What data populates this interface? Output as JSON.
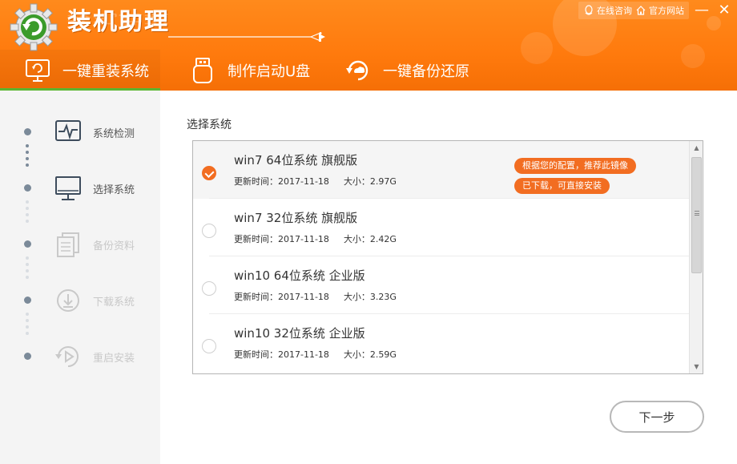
{
  "app": {
    "title": "装机助理",
    "online_consult": "在线咨询",
    "official_site": "官方网站",
    "minimize_glyph": "—",
    "close_glyph": "✕"
  },
  "tabs": [
    {
      "label": "一键重装系统",
      "icon": "reinstall-monitor-icon",
      "active": true
    },
    {
      "label": "制作启动U盘",
      "icon": "usb-drive-icon",
      "active": false
    },
    {
      "label": "一键备份还原",
      "icon": "backup-restore-icon",
      "active": false
    }
  ],
  "steps": [
    {
      "label": "系统检测",
      "icon": "pulse-monitor-icon",
      "state": "done"
    },
    {
      "label": "选择系统",
      "icon": "desktop-monitor-icon",
      "state": "done"
    },
    {
      "label": "备份资料",
      "icon": "documents-icon",
      "state": "pending"
    },
    {
      "label": "下载系统",
      "icon": "download-icon",
      "state": "pending"
    },
    {
      "label": "重启安装",
      "icon": "restart-play-icon",
      "state": "pending"
    }
  ],
  "main": {
    "section_title": "选择系统",
    "systems": [
      {
        "name": "win7 64位系统 旗舰版",
        "update_label": "更新时间：2017-11-18",
        "size_label": "大小：2.97G",
        "selected": true
      },
      {
        "name": "win7 32位系统 旗舰版",
        "update_label": "更新时间：2017-11-18",
        "size_label": "大小：2.42G",
        "selected": false
      },
      {
        "name": "win10 64位系统 企业版",
        "update_label": "更新时间：2017-11-18",
        "size_label": "大小：3.23G",
        "selected": false
      },
      {
        "name": "win10 32位系统 企业版",
        "update_label": "更新时间：2017-11-18",
        "size_label": "大小：2.59G",
        "selected": false
      }
    ],
    "badges": {
      "recommend": "根据您的配置，推荐此镜像",
      "downloaded": "已下载，可直接安装"
    },
    "next_button": "下一步"
  },
  "colors": {
    "header_orange": "#ff7a0d",
    "accent_orange": "#f26d21",
    "active_tab_green": "#5cb531",
    "sidebar_bg": "#f4f4f4"
  }
}
